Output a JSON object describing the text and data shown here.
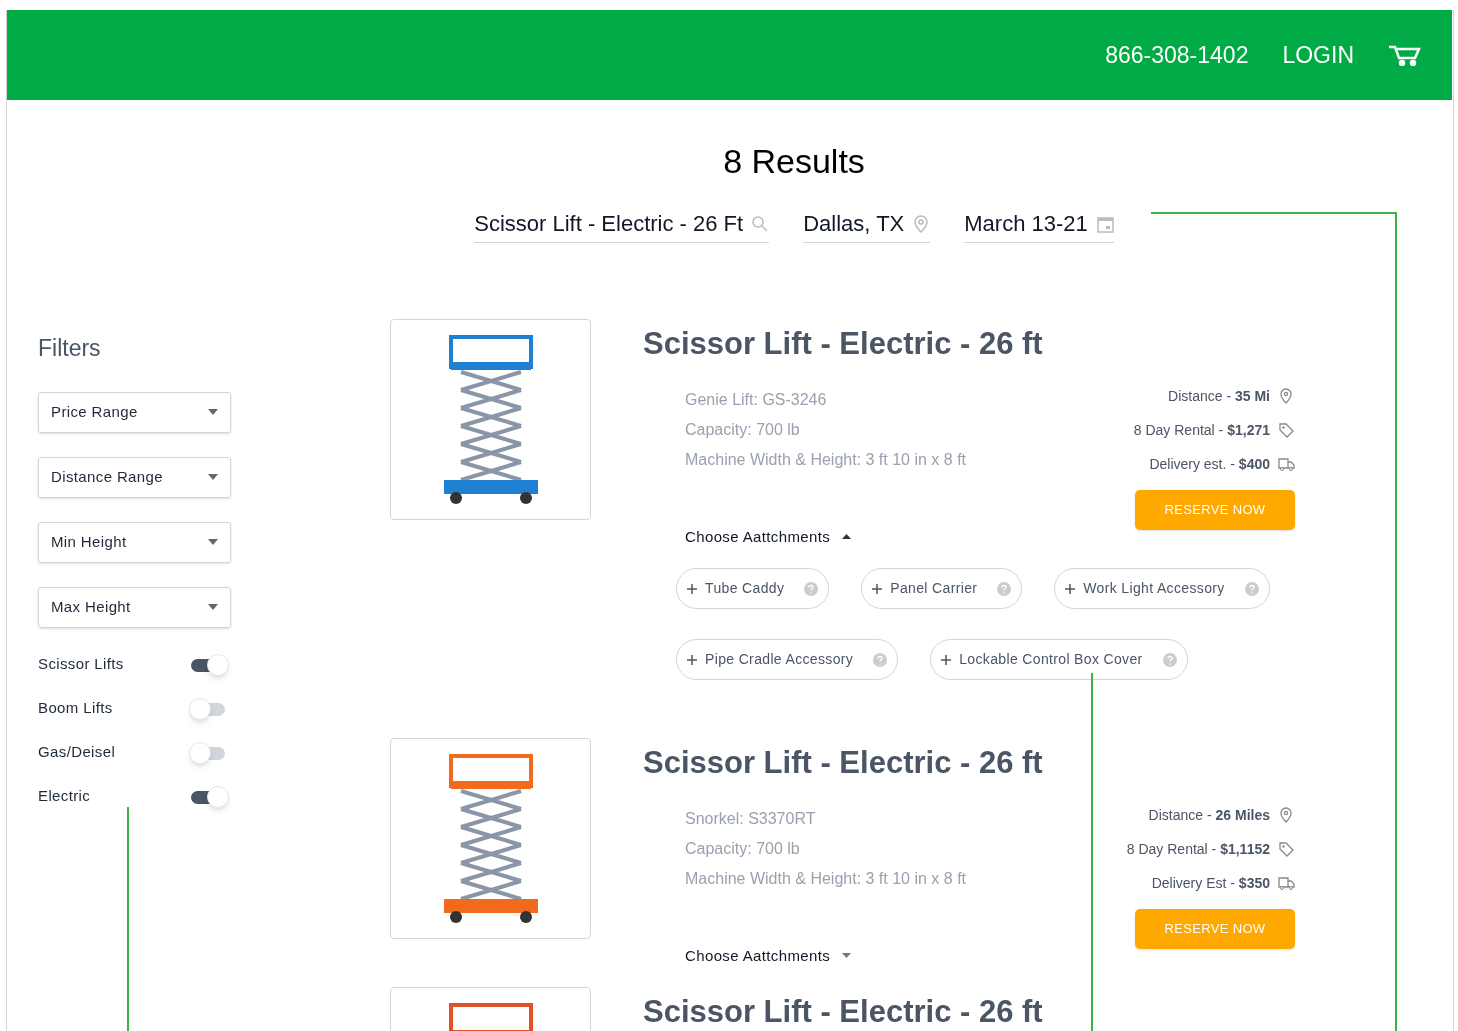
{
  "header": {
    "phone": "866-308-1402",
    "login": "LOGIN"
  },
  "results_title": "8 Results",
  "search": [
    {
      "kind": "query",
      "value": "Scissor Lift - Electric - 26 Ft"
    },
    {
      "kind": "location",
      "value": "Dallas, TX"
    },
    {
      "kind": "date",
      "value": "March 13-21"
    }
  ],
  "filters": {
    "title": "Filters",
    "dropdowns": [
      "Price Range",
      "Distance Range",
      "Min Height",
      "Max Height"
    ],
    "toggles": [
      {
        "label": "Scissor Lifts",
        "on": true
      },
      {
        "label": "Boom Lifts",
        "on": false
      },
      {
        "label": "Gas/Deisel",
        "on": false
      },
      {
        "label": "Electric",
        "on": true
      }
    ]
  },
  "products": [
    {
      "title": "Scissor Lift - Electric - 26 ft",
      "color": "#1f7fd0",
      "specs": [
        "Genie Lift: GS-3246",
        "Capacity: 700 lb",
        "Machine Width & Height: 3 ft 10 in x 8 ft"
      ],
      "details": [
        {
          "kind": "distance",
          "text": "Distance - **35 Mi**"
        },
        {
          "kind": "price",
          "text": "8 Day Rental - **$1,271**"
        },
        {
          "kind": "delivery",
          "text": "Delivery est. - **$400**"
        }
      ],
      "reserve": "RESERVE NOW",
      "attachments_label": "Choose Aattchments",
      "expanded": true,
      "attachments": [
        "Tube Caddy",
        "Panel Carrier",
        "Work Light Accessory",
        "Pipe Cradle Accessory",
        "Lockable Control Box Cover"
      ]
    },
    {
      "title": "Scissor Lift - Electric - 26 ft",
      "color": "#f26a1b",
      "specs": [
        "Snorkel: S3370RT",
        "Capacity: 700 lb",
        "Machine Width & Height: 3 ft 10 in x 8 ft"
      ],
      "details": [
        {
          "kind": "distance",
          "text": "Distance - **26 Miles**"
        },
        {
          "kind": "price",
          "text": "8 Day Rental - **$1,1152**"
        },
        {
          "kind": "delivery",
          "text": "Delivery Est - **$350**"
        }
      ],
      "reserve": "RESERVE NOW",
      "attachments_label": "Choose Aattchments",
      "expanded": false
    },
    {
      "title": "Scissor Lift - Electric - 26 ft",
      "color": "#e0522a"
    }
  ]
}
